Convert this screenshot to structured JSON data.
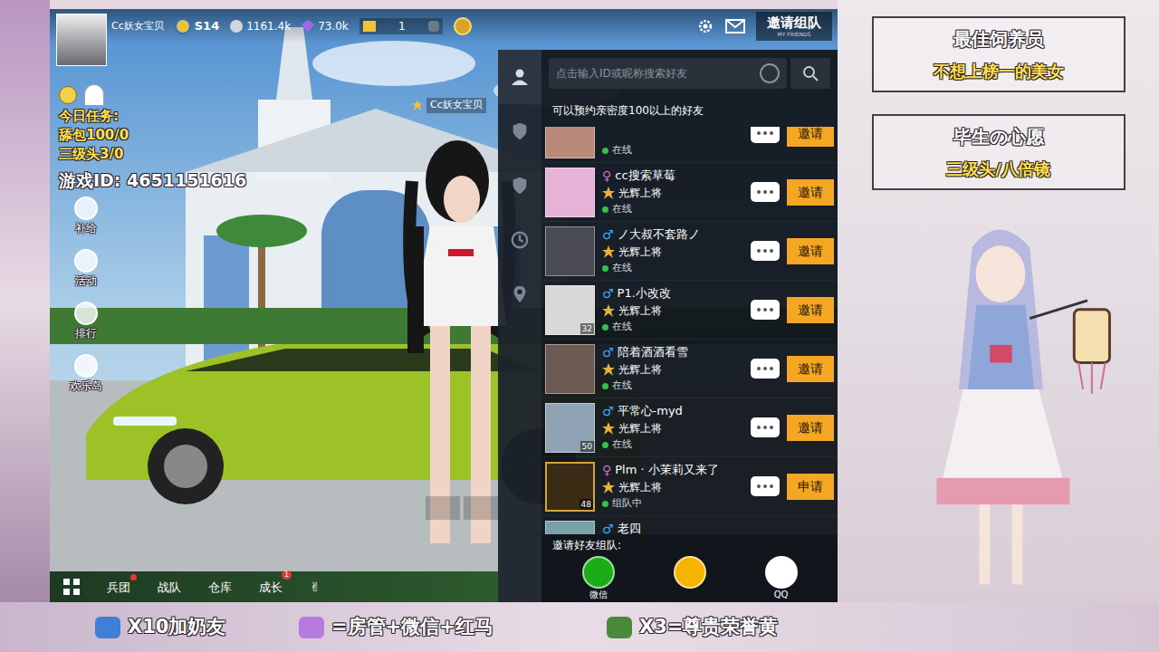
{
  "player": {
    "name": "Cc妖女宝贝",
    "season": "S14",
    "coins": "1161.4k",
    "diamonds": "73.0k",
    "tickets": "1"
  },
  "invite_button": {
    "label": "邀请组队",
    "sub": "MY FRIENDS"
  },
  "overlay": {
    "task_title": "今日任务:",
    "tasks": [
      "舔包100/0",
      "三级头3/0"
    ],
    "game_id": "游戏ID: 4651151616"
  },
  "side_menu": [
    "补给",
    "活动",
    "排行",
    "欢乐岛"
  ],
  "character_label": "Cc妖女宝贝",
  "bottom_nav": [
    {
      "label": "兵团",
      "dot": true
    },
    {
      "label": "战队",
      "dot": false
    },
    {
      "label": "仓库",
      "dot": false
    },
    {
      "label": "成长",
      "dot": false,
      "badge": "1"
    }
  ],
  "friends_panel": {
    "tabs": [
      {
        "selected": true
      },
      {
        "selected": false
      },
      {
        "selected": false
      },
      {
        "selected": false
      },
      {
        "selected": false
      }
    ],
    "search": {
      "placeholder": "点击输入ID或昵称搜索好友"
    },
    "note": "可以预约亲密度100以上的好友",
    "friends": [
      {
        "status": "在线",
        "status_color": "#35c24a",
        "button": "邀请"
      },
      {
        "name": "cc搜索草莓",
        "gender": "♀",
        "gender_color": "#d966d6",
        "rank": "光辉上将",
        "status": "在线",
        "status_color": "#35c24a",
        "button": "邀请"
      },
      {
        "name": "ノ大叔不套路ノ",
        "gender": "♂",
        "gender_color": "#3fa9f5",
        "rank": "光辉上将",
        "status": "在线",
        "status_color": "#35c24a",
        "button": "邀请"
      },
      {
        "name": "P1.小改改",
        "gender": "♂",
        "gender_color": "#3fa9f5",
        "rank": "光辉上将",
        "status": "在线",
        "status_color": "#35c24a",
        "level": "32",
        "button": "邀请"
      },
      {
        "name": "陪着酒酒看雪",
        "gender": "♂",
        "gender_color": "#3fa9f5",
        "rank": "光辉上将",
        "status": "在线",
        "status_color": "#35c24a",
        "button": "邀请"
      },
      {
        "name": "平常心-myd",
        "gender": "♂",
        "gender_color": "#3fa9f5",
        "rank": "光辉上将",
        "status": "在线",
        "status_color": "#35c24a",
        "level": "50",
        "button": "邀请"
      },
      {
        "name": "Plm · 小茉莉又来了",
        "gender": "♀",
        "gender_color": "#d966d6",
        "rank": "光辉上将",
        "status": "组队中",
        "status_color": "#35c24a",
        "level": "48",
        "button": "申请"
      },
      {
        "name": "老四",
        "gender": "♂",
        "gender_color": "#3fa9f5"
      }
    ],
    "share": {
      "title": "邀请好友组队:",
      "options": [
        {
          "label": "微信",
          "color": "#1aad19"
        },
        {
          "color": "#f4b400"
        },
        {
          "label": "QQ",
          "color": "#ffffff"
        }
      ]
    }
  },
  "right_panel": {
    "boxes": [
      {
        "title": "最佳饲养员",
        "value": "不想上榜一的美女"
      },
      {
        "title": "毕生の心愿",
        "value": "三级头/八倍镜"
      }
    ]
  },
  "banner": [
    "X10加奶友",
    "=房管+微信+红马",
    "X3=尊贵荣誉黄"
  ]
}
